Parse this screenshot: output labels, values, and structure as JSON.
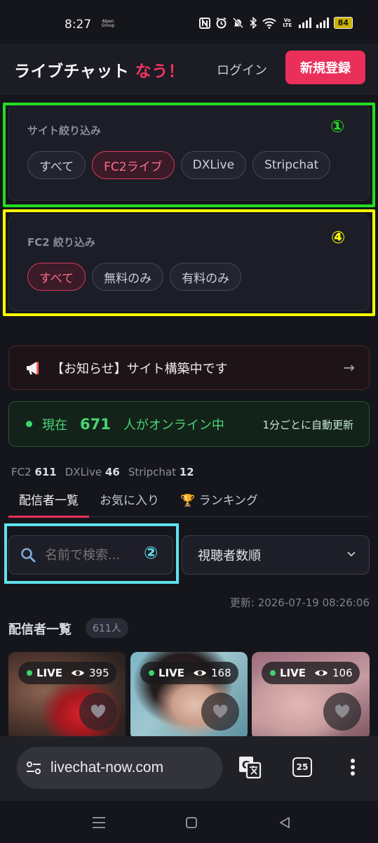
{
  "status_bar": {
    "time": "8:27",
    "brand": "Alpen Group",
    "battery": "84",
    "volte": "Vo LTE"
  },
  "header": {
    "logo_main": "ライブチャット",
    "logo_accent": "なう！",
    "login_label": "ログイン",
    "signup_label": "新規登録"
  },
  "site_filter": {
    "label": "サイト絞り込み",
    "annotation": "①",
    "annotation_color": "#22dd22",
    "options": [
      "すべて",
      "FC2ライブ",
      "DXLive",
      "Stripchat"
    ],
    "selected": "FC2ライブ"
  },
  "fc2_filter": {
    "label": "FC2 絞り込み",
    "annotation": "④",
    "annotation_color": "#ffff00",
    "options": [
      "すべて",
      "無料のみ",
      "有料のみ"
    ],
    "selected": "すべて"
  },
  "notice": {
    "text": "【お知らせ】サイト構築中です",
    "arrow": "→"
  },
  "online": {
    "prefix": "現在",
    "count": "671",
    "suffix": "人がオンライン中",
    "auto_update": "1分ごとに自動更新"
  },
  "site_counts": [
    {
      "site": "FC2",
      "count": "611"
    },
    {
      "site": "DXLive",
      "count": "46"
    },
    {
      "site": "Stripchat",
      "count": "12"
    }
  ],
  "tabs": {
    "broadcasters": "配信者一覧",
    "favorites": "お気に入り",
    "ranking": "🏆 ランキング",
    "active": "broadcasters"
  },
  "search": {
    "placeholder": "名前で検索...",
    "annotation": "②",
    "annotation_color": "#5fe1ec"
  },
  "sort": {
    "selected": "視聴者数順"
  },
  "updated": "更新: 2026-07-19 08:26:06",
  "list": {
    "title": "配信者一覧",
    "count": "611人",
    "cards": [
      {
        "status": "LIVE",
        "viewers": "395"
      },
      {
        "status": "LIVE",
        "viewers": "168"
      },
      {
        "status": "LIVE",
        "viewers": "106"
      }
    ]
  },
  "browser": {
    "url": "livechat-now.com",
    "tab_count": "25"
  },
  "colors": {
    "accent": "#ea2f5a",
    "online_green": "#48d676",
    "bg": "#15161c",
    "panel": "#1c1d27"
  }
}
